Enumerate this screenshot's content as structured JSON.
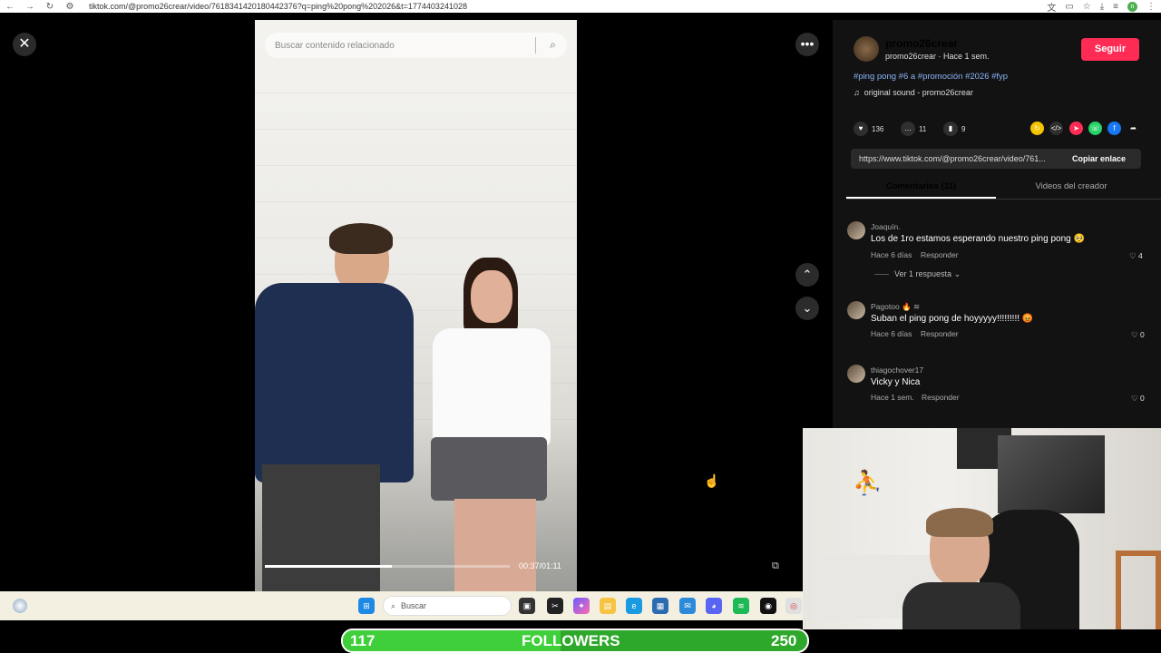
{
  "browser": {
    "url": "tiktok.com/@promo26crear/video/7618341420180442376?q=ping%20pong%202026&t=1774403241028",
    "icons": [
      "back-icon",
      "forward-icon",
      "reload-icon",
      "site-info-icon",
      "translate-icon",
      "cast-icon",
      "star-icon",
      "download-icon",
      "reading-list-icon",
      "profile-icon",
      "menu-icon"
    ],
    "profile_initial": "n"
  },
  "player": {
    "search_placeholder": "Buscar contenido relacionado",
    "time": "00:37/01:11",
    "progress": 0.52
  },
  "post": {
    "username": "promo26crear",
    "subline": "promo26crear · Hace 1 sem.",
    "follow_label": "Seguir",
    "tags": "#ping pong #6 a #promoción #2026 #fyp",
    "sound": "original sound - promo26crear",
    "likes": "136",
    "comments": "11",
    "saves": "9",
    "link": "https://www.tiktok.com/@promo26crear/video/761...",
    "copy_label": "Copiar enlace"
  },
  "tabs": [
    "Comentarios (11)",
    "Videos del creador"
  ],
  "comments": [
    {
      "user": "Joaquín.",
      "text": "Los de 1ro estamos esperando nuestro ping pong 🥺",
      "meta": "Hace 6 días",
      "reply": "Responder",
      "likes": "4",
      "replies_label": "Ver 1 respuesta"
    },
    {
      "user": "Pagotoo 🔥 ≋",
      "text": "Suban el ping pong de hoyyyyy!!!!!!!!! 😡",
      "meta": "Hace 6 días",
      "reply": "Responder",
      "likes": "0"
    },
    {
      "user": "thiagochover17",
      "text": "Vicky y Nica",
      "meta": "Hace 1 sem.",
      "reply": "Responder",
      "likes": "0"
    }
  ],
  "taskbar": {
    "search_label": "Buscar"
  },
  "followers": {
    "current": "117",
    "label": "FOLLOWERS",
    "goal": "250",
    "progress": 0.468
  },
  "colors": {
    "follow": "#fe2c55",
    "tags": "#8ab4f8",
    "followers_bar": "#3fcf3a"
  }
}
